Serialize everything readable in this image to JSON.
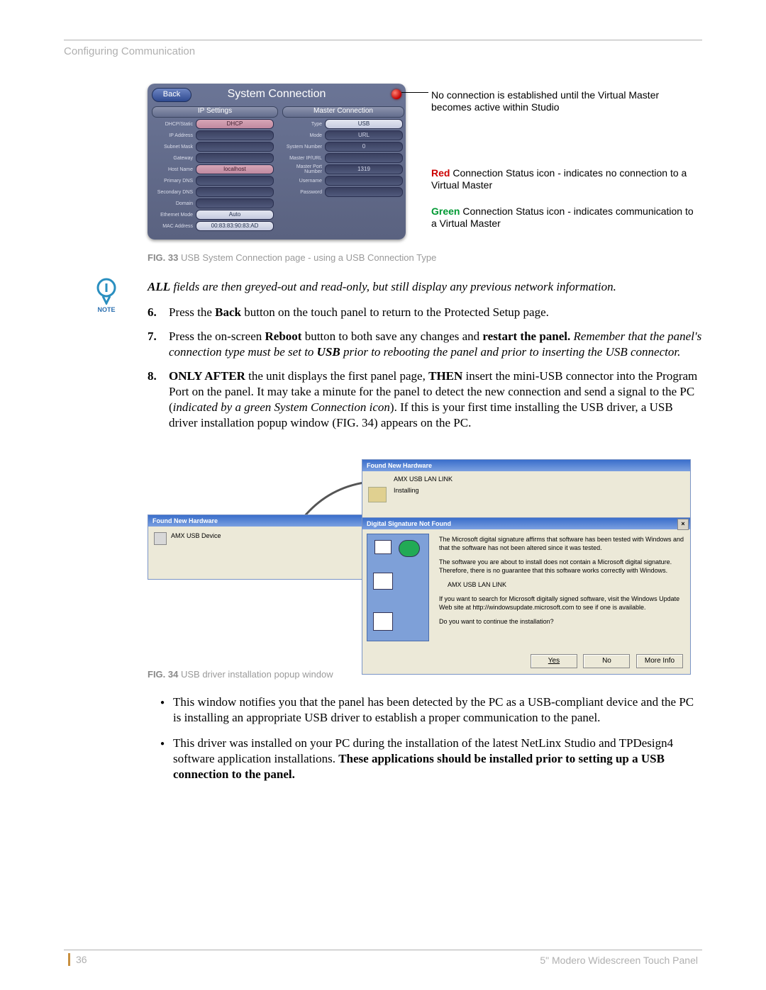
{
  "chapter": "Configuring Communication",
  "page_number": "36",
  "manual_title": "5\" Modero Widescreen Touch Panel",
  "panel": {
    "title": "System Connection",
    "back": "Back",
    "left_header": "IP Settings",
    "right_header": "Master Connection",
    "left_rows": [
      {
        "label": "DHCP/Static",
        "value": "DHCP",
        "cls": "pink"
      },
      {
        "label": "IP Address",
        "value": ""
      },
      {
        "label": "Subnet Mask",
        "value": ""
      },
      {
        "label": "Gateway",
        "value": ""
      },
      {
        "label": "Host Name",
        "value": "localhost",
        "cls": "pink"
      },
      {
        "label": "Primary DNS",
        "value": ""
      },
      {
        "label": "Secondary DNS",
        "value": ""
      },
      {
        "label": "Domain",
        "value": ""
      },
      {
        "label": "Ethernet Mode",
        "value": "Auto",
        "cls": "white"
      },
      {
        "label": "MAC Address",
        "value": "00:83:83:90:83:AD",
        "cls": "white"
      }
    ],
    "right_rows": [
      {
        "label": "Type",
        "value": "USB",
        "cls": "white"
      },
      {
        "label": "Mode",
        "value": "URL"
      },
      {
        "label": "System Number",
        "value": "0"
      },
      {
        "label": "Master IP/URL",
        "value": ""
      },
      {
        "label": "Master Port Number",
        "value": "1319"
      },
      {
        "label": "Username",
        "value": ""
      },
      {
        "label": "Password",
        "value": ""
      }
    ]
  },
  "callouts": {
    "c1": "No connection is established until the Virtual Master becomes active within Studio",
    "c2a": "Red",
    "c2b": " Connection Status icon - indicates no connection to a Virtual Master",
    "c3a": "Green",
    "c3b": " Connection Status icon - indicates communication to a Virtual Master"
  },
  "fig33": {
    "prefix": "FIG. 33",
    "text": "  USB System Connection page - using a USB Connection Type"
  },
  "note_label": "NOTE",
  "note_text_1": "ALL",
  "note_text_2": " fields are then greyed-out and read-only, but still display any previous network information.",
  "steps": {
    "s6_num": "6.",
    "s6a": "Press the ",
    "s6b": "Back",
    "s6c": " button on the touch panel to return to the Protected Setup page.",
    "s7_num": "7.",
    "s7a": "Press the on-screen ",
    "s7b": "Reboot",
    "s7c": " button to both save any changes and ",
    "s7d": "restart the panel.",
    "s7e": " Remember that the panel's connection type must be set to ",
    "s7f": "USB",
    "s7g": " prior to rebooting the panel and prior to inserting the USB connector.",
    "s8_num": "8.",
    "s8a": "ONLY AFTER",
    "s8b": " the unit displays the first panel page, ",
    "s8c": "THEN",
    "s8d": " insert the mini-USB connector into the Program Port on the panel. It may take a minute for the panel to detect the new connection and send a signal to the PC (",
    "s8e": "indicated by a green System Connection icon",
    "s8f": "). If this is your first time installing the USB driver, a USB driver installation popup window (FIG. 34) appears on the PC."
  },
  "fig34": {
    "fnh_title": "Found New Hardware",
    "fnh1_device": "AMX USB Device",
    "fnh2_device": "AMX USB LAN LINK",
    "fnh2_status": "Installing",
    "dsn_title": "Digital Signature Not Found",
    "dsn_p1": "The Microsoft digital signature affirms that software has been tested with Windows and that the software has not been altered since it was tested.",
    "dsn_p2": "The software you are about to install does not contain a Microsoft digital signature. Therefore, there is no guarantee that this software works correctly with Windows.",
    "dsn_device": "AMX USB LAN LINK",
    "dsn_p3": "If you want to search for Microsoft digitally signed software, visit the Windows Update Web site at http://windowsupdate.microsoft.com to see if one is available.",
    "dsn_q": "Do you want to continue the installation?",
    "btn_yes": "Yes",
    "btn_no": "No",
    "btn_more": "More Info",
    "close_x": "×"
  },
  "fig34_caption": {
    "prefix": "FIG. 34",
    "text": "  USB driver installation popup window"
  },
  "bullets": {
    "b1": "This window notifies you that the panel has been detected by the PC as a USB-compliant device and the PC is installing an appropriate USB driver to establish a proper communication to the panel.",
    "b2a": "This driver was installed on your PC during the installation of the latest NetLinx Studio and TPDesign4 software application installations. ",
    "b2b": "These applications should be installed prior to setting up a USB connection to the panel."
  }
}
